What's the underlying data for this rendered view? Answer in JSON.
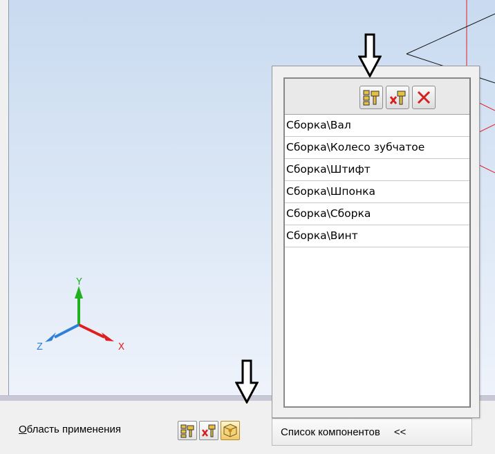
{
  "popup": {
    "components": [
      "Сборка\\Вал",
      "Сборка\\Колесо зубчатое",
      "Сборка\\Штифт",
      "Сборка\\Шпонка",
      "Сборка\\Сборка",
      "Сборка\\Винт"
    ],
    "toolbar_icons": [
      "select-components-icon",
      "exclude-components-icon",
      "delete-icon"
    ]
  },
  "status_bar": {
    "area_label_first": "О",
    "area_label_rest": "бласть применения",
    "list_button_label": "Список компонентов",
    "list_button_chevron": "<<"
  },
  "axes": {
    "x": "X",
    "y": "Y",
    "z": "Z"
  },
  "colors": {
    "x_axis": "#e02020",
    "y_axis": "#20b020",
    "z_axis": "#2f7fd8",
    "delete_red": "#d62020",
    "selected_button": "#f1c86a"
  }
}
